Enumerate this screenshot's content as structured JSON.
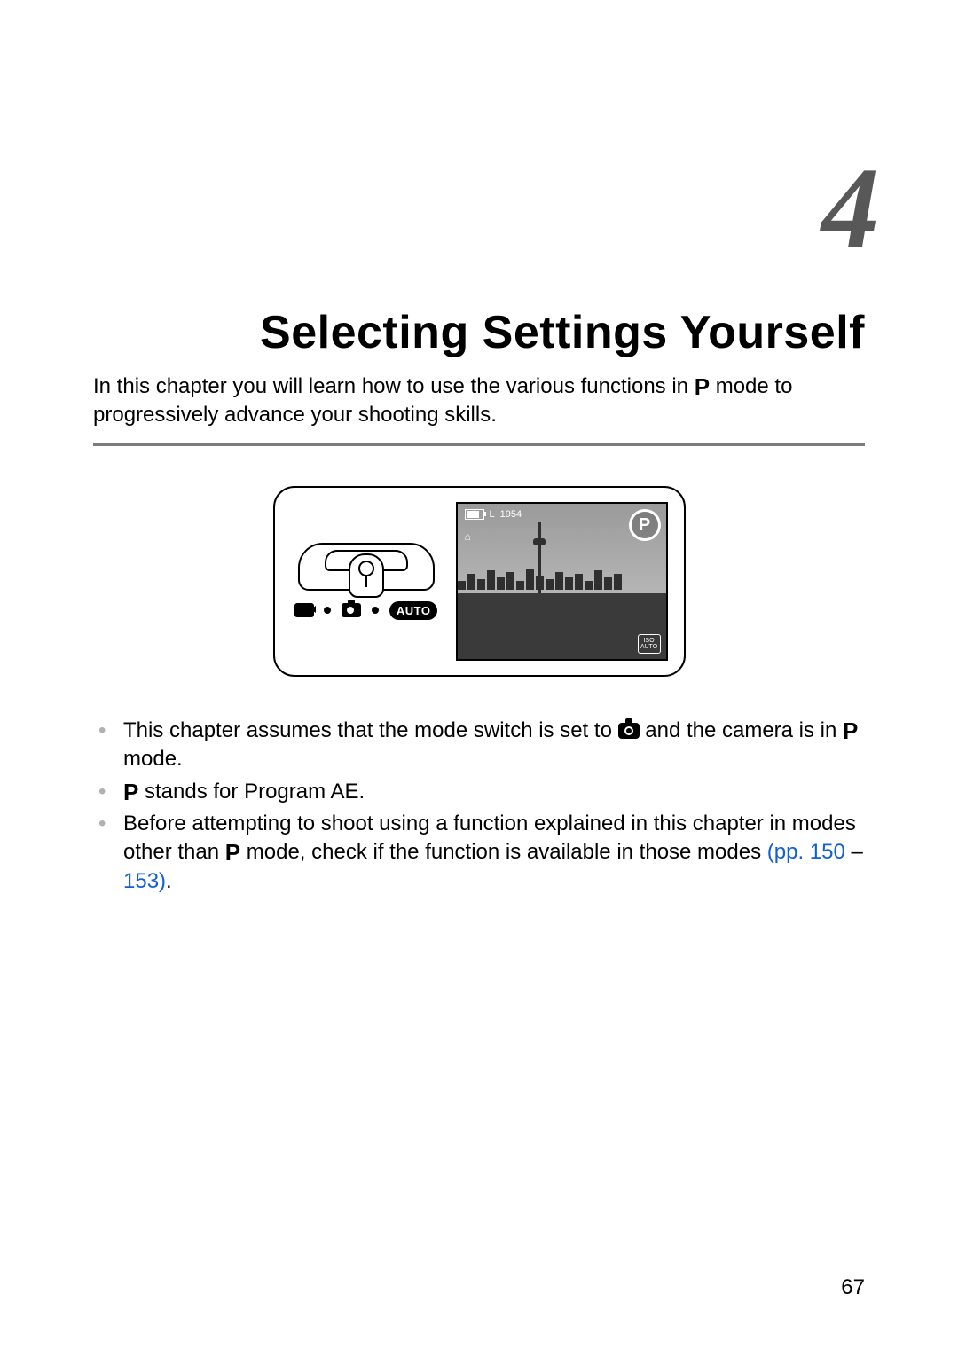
{
  "chapter": {
    "number": "4",
    "title": "Selecting Settings Yourself",
    "intro_pre": "In this chapter you will learn how to use the various functions in ",
    "intro_post": " mode to progressively advance your shooting skills."
  },
  "illustration": {
    "switch_auto_label": "AUTO",
    "lcd": {
      "mode_badge": "P",
      "shots": "1954",
      "size_indicator": "L",
      "iso_top": "ISO",
      "iso_bottom": "AUTO",
      "lock_glyph": "⌂"
    }
  },
  "bullets": {
    "b1_pre": "This chapter assumes that the mode switch is set to ",
    "b1_mid": " and the camera is in ",
    "b1_post": " mode.",
    "b2_post": " stands for Program AE.",
    "b3_pre": "Before attempting to shoot using a function explained in this chapter in modes other than ",
    "b3_mid": " mode, check if the function is available in those modes ",
    "b3_link1": "(pp. 150",
    "b3_dash": " – ",
    "b3_link2": "153)",
    "b3_post": "."
  },
  "icons": {
    "p_glyph": "P"
  },
  "page_number": "67"
}
